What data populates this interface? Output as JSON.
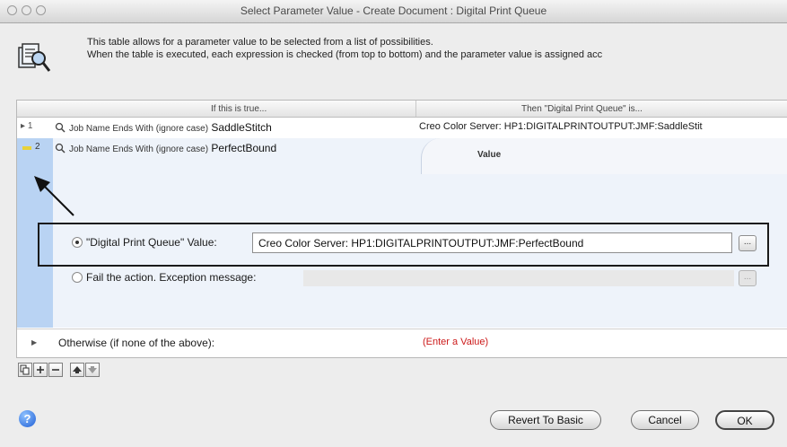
{
  "window": {
    "title": "Select Parameter Value - Create Document : Digital Print Queue"
  },
  "header": {
    "icon": "magnifier-list-icon",
    "line1": "This table allows for a parameter value to be selected from a list of possibilities.",
    "line2": "When the table is executed, each expression is checked (from top to bottom) and the parameter value is assigned acc"
  },
  "table": {
    "columns": [
      "If this is true...",
      "Then \"Digital Print Queue\" is..."
    ],
    "rows": [
      {
        "number": "1",
        "condition_label": "Job Name Ends With (ignore case)",
        "condition_value": "SaddleStitch",
        "then": "Creo Color Server: HP1:DIGITALPRINTOUTPUT:JMF:SaddleStit"
      },
      {
        "number": "2",
        "condition_label": "Job Name Ends With (ignore case)",
        "condition_value": "PerfectBound",
        "then": ""
      }
    ],
    "expanded": {
      "tab_label": "Value",
      "option1_label": "\"Digital Print Queue\" Value:",
      "option1_value": "Creo Color Server: HP1:DIGITALPRINTOUTPUT:JMF:PerfectBound",
      "option2_label": "Fail the action.  Exception message:",
      "ellipsis": "..."
    },
    "otherwise": {
      "label": "Otherwise (if none of the above):",
      "value": "(Enter a Value)"
    }
  },
  "toolbar": {
    "buttons": [
      "duplicate-icon",
      "add-icon",
      "remove-icon",
      "move-up-icon",
      "move-down-icon"
    ]
  },
  "footer": {
    "help": "?",
    "revert": "Revert To Basic",
    "cancel": "Cancel",
    "ok": "OK"
  }
}
